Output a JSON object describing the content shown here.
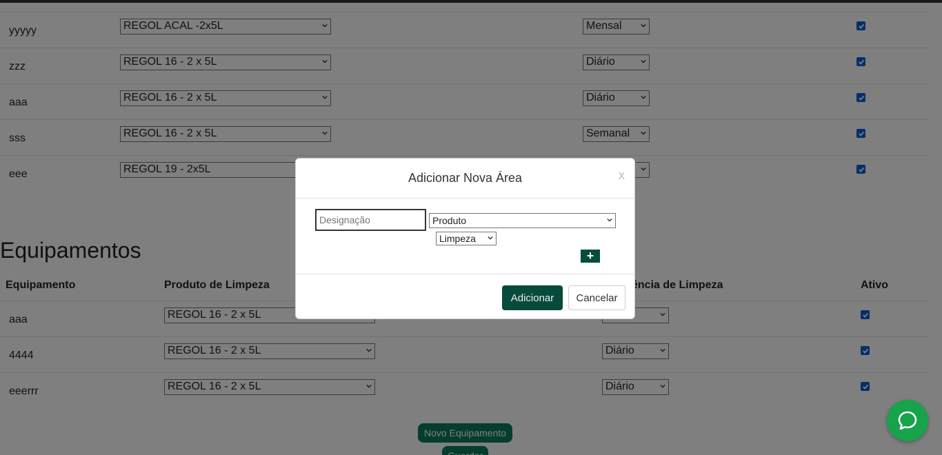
{
  "areas": {
    "rows": [
      {
        "name": "yyyyy",
        "product": "REGOL ACAL -2x5L",
        "frequency": "Mensal",
        "active": true
      },
      {
        "name": "zzz",
        "product": "REGOL 16 - 2 x 5L",
        "frequency": "Diário",
        "active": true
      },
      {
        "name": "aaa",
        "product": "REGOL 16 - 2 x 5L",
        "frequency": "Diário",
        "active": true
      },
      {
        "name": "sss",
        "product": "REGOL 16 - 2 x 5L",
        "frequency": "Semanal",
        "active": true
      },
      {
        "name": "eee",
        "product": "REGOL 19 - 2x5L",
        "frequency": "",
        "active": true
      }
    ]
  },
  "equipamentos": {
    "title": "Equipamentos",
    "headers": {
      "equipment": "Equipamento",
      "product": "Produto de Limpeza",
      "frequency": "ência de Limpeza",
      "active": "Ativo"
    },
    "rows": [
      {
        "name": "aaa",
        "product": "REGOL 16 - 2 x 5L",
        "frequency": "",
        "active": true
      },
      {
        "name": "4444",
        "product": "REGOL 16 - 2 x 5L",
        "frequency": "Diário",
        "active": true
      },
      {
        "name": "eeerrr",
        "product": "REGOL 16 - 2 x 5L",
        "frequency": "Diário",
        "active": true
      }
    ],
    "new_button": "Novo Equipamento",
    "save_button": "Guardar"
  },
  "modal": {
    "title": "Adicionar Nova Área",
    "close_label": "x",
    "designacao_placeholder": "Designação",
    "produto_selected": "Produto",
    "tipo_selected": "Limpeza",
    "plus_label": "+",
    "add_button": "Adicionar",
    "cancel_button": "Cancelar"
  },
  "colors": {
    "primary": "#064b3b",
    "accent": "#0a7a5c",
    "checkbox": "#0b5ed7",
    "chat": "#16a34a"
  },
  "icons": {
    "chat": "chat-bubble-icon",
    "dropdown": "chevron-down-icon",
    "checkbox": "check-icon"
  }
}
